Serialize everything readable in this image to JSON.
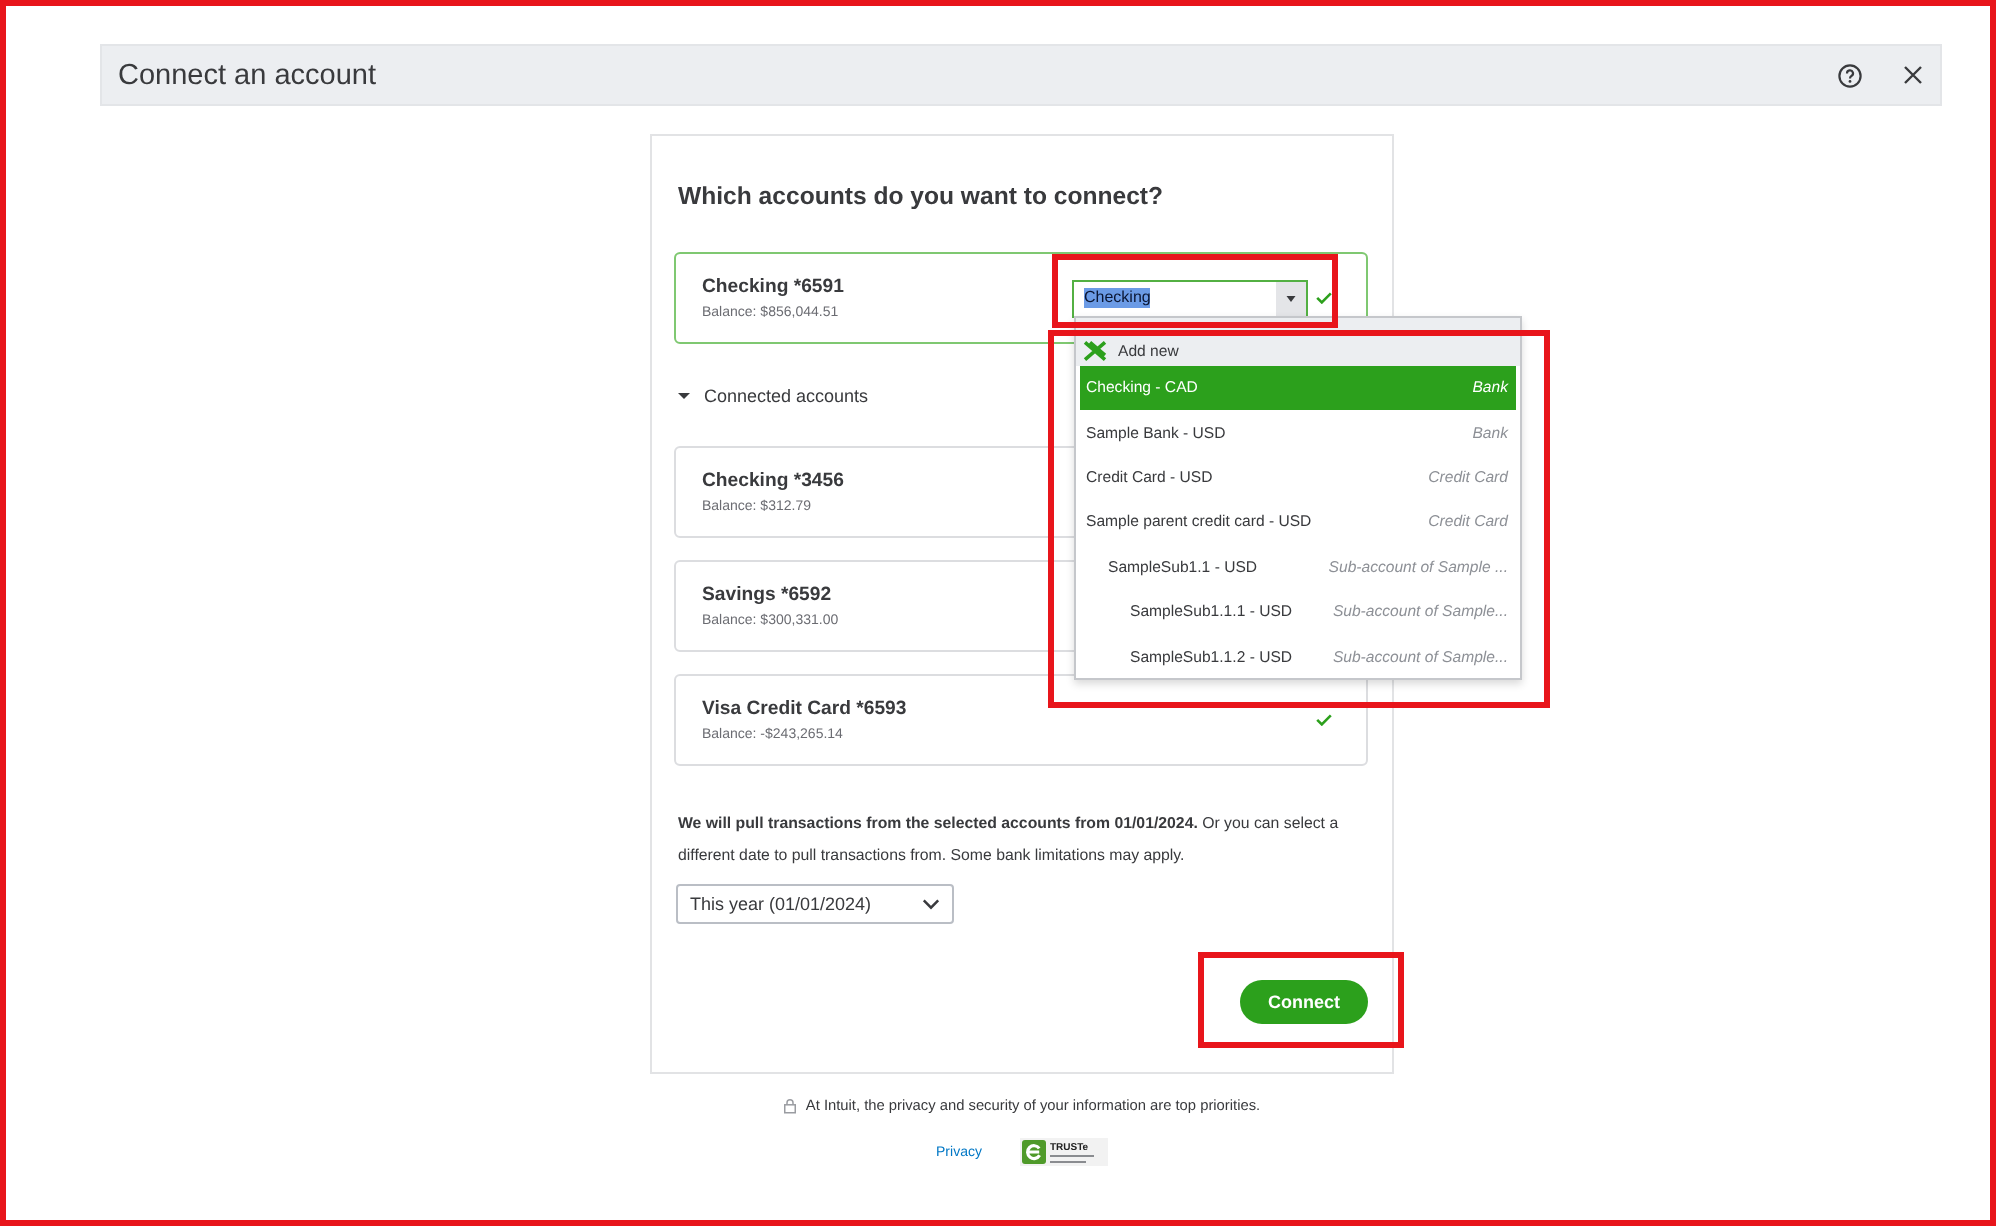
{
  "annotation_frame": true,
  "window": {
    "title": "Connect an account"
  },
  "heading": "Which accounts do you want to connect?",
  "selected_account": {
    "name": "Checking *6591",
    "balance": "Balance: $856,044.51",
    "checked": true,
    "account_field": {
      "value": "Checking",
      "value_selected": true,
      "highlighted": true
    },
    "account_menu": {
      "highlighted": true,
      "add_new": "Add new",
      "items": [
        {
          "name": "Checking - CAD",
          "type": "Bank",
          "selected": true
        },
        {
          "name": "Sample Bank - USD",
          "type": "Bank",
          "selected": false
        },
        {
          "name": "Credit Card - USD",
          "type": "Credit Card",
          "selected": false
        },
        {
          "name": "Sample parent credit card - USD",
          "type": "Credit Card",
          "selected": false,
          "children": [
            {
              "name": "SampleSub1.1 - USD",
              "type": "Sub-account of Sample ...",
              "selected": false,
              "children": [
                {
                  "name": "SampleSub1.1.1 - USD",
                  "type": "Sub-account of Sample...",
                  "selected": false
                },
                {
                  "name": "SampleSub1.1.2 - USD",
                  "type": "Sub-account of Sample...",
                  "selected": false
                }
              ]
            }
          ]
        }
      ]
    }
  },
  "connected_accounts": {
    "label": "Connected accounts",
    "expanded": true,
    "accounts": [
      {
        "name": "Checking *3456",
        "balance": "Balance: $312.79",
        "checked": false
      },
      {
        "name": "Savings *6592",
        "balance": "Balance: $300,331.00",
        "checked": false
      },
      {
        "name": "Visa Credit Card *6593",
        "balance": "Balance: -$243,265.14",
        "checked": true
      }
    ]
  },
  "date_note": "**We will pull transactions from the selected accounts from 01/01/2024.** Or you can select a different date to pull transactions from. Some bank limitations may apply.",
  "date_range_select": {
    "value": "This year (01/01/2024)"
  },
  "connect_button": {
    "label": "Connect",
    "highlighted": true
  },
  "footer": {
    "privacy_note": "At Intuit, the privacy and security of your information are top priorities.",
    "privacy_link": "Privacy",
    "badge": "TRUSTe"
  }
}
